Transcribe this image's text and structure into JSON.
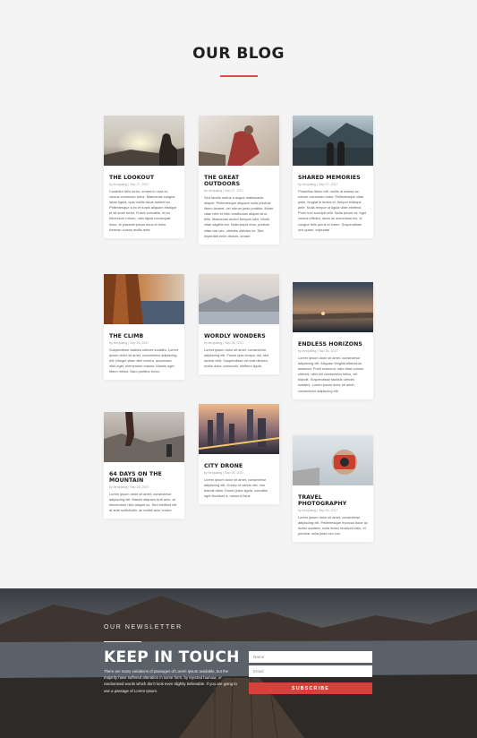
{
  "section_title": "OUR BLOG",
  "posts": [
    {
      "title": "THE LOOKOUT",
      "meta": "by benjusing | Sep 27, 2017",
      "excerpt": "Curabitur felis tortor, ornare in urna et, cursus commodo tortor. Maecenas congue lacus ligula, quis mollis lacus laoreet eu. Pellentesque a ex et turpis aliquam tristique et sit amet tortor. Fusce convallis, mi eu bibendum rutrum, odio ligula consequat risus, at placerat ipsum risus et enim. Aenean cursus mollis ante."
    },
    {
      "title": "THE GREAT OUTDOORS",
      "meta": "by benjusing | Sep 27, 2017",
      "excerpt": "Sed iaculis metus a augue malesuada aliquet. Pellentesque aliquam nulla pulvinar libero laoreet, vel rutrum justo porttitor. Morbi vitae nibh et nibh vestibulum aliquet at ut felis. Maecenas auctor tempus odio. Morbi vitae sagittis est. Nulla turpis eros, pretium vitae nisi nec, ultricies ultricies ex. Sed imperdiet enim dictum, ornare."
    },
    {
      "title": "SHARED MEMORIES",
      "meta": "by benjusing | Sep 27, 2017",
      "excerpt": "Phasellus libero elit, mollis at massa ac, rutrum commodo tortor. Pellentesque vitae justo, feugiat in lectus et, tempor tristique ante. Nulla tempor ut ligula vitae eleifend. Proin non suscipit velit. Nulla ipsum mi, eget cursus efficitur, lacus ac accumsan leo, id congue felis purus id lorem. Suspendisse orci quam, vulputate."
    },
    {
      "title": "THE CLIMB",
      "meta": "by benjusing | Sep 26, 2017",
      "excerpt": "Suspendisse facilisis ultrices sodales. Lorem ipsum dolor sit amet, consectetur adipiscing elit. Integer vitae nibh viverra, accumsan nibh eget, elementum mauris. Mauris eget libero metus. Nam porttitor tortor."
    },
    {
      "title": "WORDLY WONDERS",
      "meta": "by benjusing | Sep 26, 2017",
      "excerpt": "Lorem ipsum dolor sit amet, consectetur adipiscing elit. Fusce quis tempor dui, sed lacinia velit. Suspendisse vel erat ultrices, mollis dolor commodo, eleifend ligula."
    },
    {
      "title": "ENDLESS HORIZONS",
      "meta": "by benjusing | Sep 26, 2017",
      "excerpt": "Lorem ipsum dolor sit amet, consectetur adipiscing elit. Aliquam fringilla bibendum euismod. Proin euismod, odio vitae cursus ultrices, nibh elit consectetur tellus, vel blandit. Suspendisse facilisis ultrices sodales. Lorem ipsum dolor sit amet, consectetur adipiscing elit."
    },
    {
      "title": "64 DAYS ON THE MOUNTAIN",
      "meta": "by benjusing | Sep 26, 2017",
      "excerpt": "Lorem ipsum dolor sit amet, consectetur adipiscing elit. Mauris aliquam erat arcu, at elementum nibh aliquet ac. Sed eleifend elit at ante sollicitudin, ac mattis arcu ornare."
    },
    {
      "title": "CITY DRONE",
      "meta": "by benjusing | Sep 26, 2017",
      "excerpt": "Lorem ipsum dolor sit amet, consectetur adipiscing elit. Donec ut varius nisi, non blandit diam. Donec justo ligula, convallis eget tincidunt a, varius a risus."
    },
    {
      "title": "TRAVEL PHOTOGRAPHY",
      "meta": "by benjusing | Sep 26, 2017",
      "excerpt": "Lorem ipsum dolor sit amet, consectetur adipiscing elit. Pellentesque rhoncus dolor ac luctus sodales, nulla lectus tincidunt odio, et pulvinar nulla justo nec orci."
    }
  ],
  "newsletter": {
    "label": "OUR NEWSLETTER",
    "title": "KEEP IN TOUCH",
    "text": "There are many variations of passages of Lorem Ipsum available, but the majority have suffered alteration in some form, by injected humour, or randomised words which don't look even slightly believable. If you are going to use a passage of Lorem Ipsum.",
    "name_placeholder": "Name",
    "email_placeholder": "Email",
    "subscribe_label": "SUBSCRIBE"
  },
  "colors": {
    "accent": "#d9403c",
    "page_bg": "#f4f4f4"
  }
}
